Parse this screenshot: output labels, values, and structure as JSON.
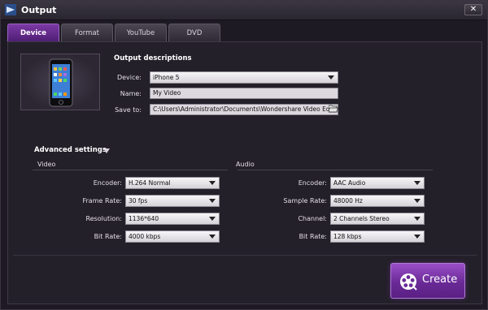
{
  "window": {
    "title": "Output",
    "close_label": "✕"
  },
  "tabs": [
    {
      "label": "Device",
      "active": true
    },
    {
      "label": "Format",
      "active": false
    },
    {
      "label": "YouTube",
      "active": false
    },
    {
      "label": "DVD",
      "active": false
    }
  ],
  "output": {
    "section_title": "Output descriptions",
    "device_label": "Device:",
    "device_value": "iPhone 5",
    "name_label": "Name:",
    "name_value": "My Video",
    "saveto_label": "Save to:",
    "saveto_value": "C:\\Users\\Administrator\\Documents\\Wondershare Video Editor"
  },
  "advanced": {
    "title": "Advanced settings"
  },
  "video": {
    "title": "Video",
    "encoder_label": "Encoder:",
    "encoder_value": "H.264 Normal",
    "framerate_label": "Frame Rate:",
    "framerate_value": "30 fps",
    "resolution_label": "Resolution:",
    "resolution_value": "1136*640",
    "bitrate_label": "Bit Rate:",
    "bitrate_value": "4000 kbps"
  },
  "audio": {
    "title": "Audio",
    "encoder_label": "Encoder:",
    "encoder_value": "AAC Audio",
    "samplerate_label": "Sample Rate:",
    "samplerate_value": "48000 Hz",
    "channel_label": "Channel:",
    "channel_value": "2 Channels Stereo",
    "bitrate_label": "Bit Rate:",
    "bitrate_value": "128 kbps"
  },
  "create": {
    "label": "Create"
  },
  "icons": {
    "app": "app-logo-icon",
    "close": "close-icon",
    "device": "phone-icon",
    "folder": "folder-open-icon",
    "dropdown": "caret-down-icon",
    "create": "film-reel-icon"
  },
  "colors": {
    "accent": "#6a2a96",
    "tab_active": "#7b3aa6",
    "background": "#1e1a24"
  }
}
